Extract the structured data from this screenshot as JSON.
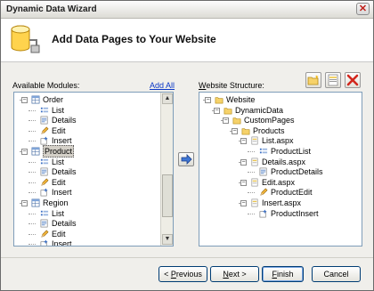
{
  "window": {
    "title": "Dynamic Data Wizard"
  },
  "header": {
    "title": "Add Data Pages to Your Website"
  },
  "modules": {
    "label": "Available Modules:",
    "add_all": "Add All",
    "items": [
      {
        "text": "Order",
        "icon": "table-icon",
        "indent": 0,
        "expander": "-"
      },
      {
        "text": "List",
        "icon": "list-icon",
        "indent": 1
      },
      {
        "text": "Details",
        "icon": "details-icon",
        "indent": 1
      },
      {
        "text": "Edit",
        "icon": "pencil-icon",
        "indent": 1
      },
      {
        "text": "Insert",
        "icon": "insert-icon",
        "indent": 1
      },
      {
        "text": "Product",
        "icon": "table-icon",
        "indent": 0,
        "expander": "-",
        "selected": true
      },
      {
        "text": "List",
        "icon": "list-icon",
        "indent": 1
      },
      {
        "text": "Details",
        "icon": "details-icon",
        "indent": 1
      },
      {
        "text": "Edit",
        "icon": "pencil-icon",
        "indent": 1
      },
      {
        "text": "Insert",
        "icon": "insert-icon",
        "indent": 1
      },
      {
        "text": "Region",
        "icon": "table-icon",
        "indent": 0,
        "expander": "-"
      },
      {
        "text": "List",
        "icon": "list-icon",
        "indent": 1
      },
      {
        "text": "Details",
        "icon": "details-icon",
        "indent": 1
      },
      {
        "text": "Edit",
        "icon": "pencil-icon",
        "indent": 1
      },
      {
        "text": "Insert",
        "icon": "insert-icon",
        "indent": 1
      }
    ]
  },
  "structure": {
    "label": "Website Structure:",
    "items": [
      {
        "text": "Website",
        "icon": "folder-icon",
        "indent": 0,
        "expander": "-"
      },
      {
        "text": "DynamicData",
        "icon": "folder-icon",
        "indent": 1,
        "expander": "-"
      },
      {
        "text": "CustomPages",
        "icon": "folder-icon",
        "indent": 2,
        "expander": "-"
      },
      {
        "text": "Products",
        "icon": "folder-icon",
        "indent": 3,
        "expander": "-"
      },
      {
        "text": "List.aspx",
        "icon": "page-icon",
        "indent": 4,
        "expander": "-"
      },
      {
        "text": "ProductList",
        "icon": "list-icon",
        "indent": 5
      },
      {
        "text": "Details.aspx",
        "icon": "page-icon",
        "indent": 4,
        "expander": "-"
      },
      {
        "text": "ProductDetails",
        "icon": "details-icon",
        "indent": 5
      },
      {
        "text": "Edit.aspx",
        "icon": "page-icon",
        "indent": 4,
        "expander": "-"
      },
      {
        "text": "ProductEdit",
        "icon": "pencil-icon",
        "indent": 5
      },
      {
        "text": "Insert.aspx",
        "icon": "page-icon",
        "indent": 4,
        "expander": "-"
      },
      {
        "text": "ProductInsert",
        "icon": "insert-icon",
        "indent": 5
      }
    ]
  },
  "toolbar": {
    "new_folder": "new-folder-icon",
    "new_page": "new-page-icon",
    "delete": "delete-icon"
  },
  "buttons": {
    "previous_pre": "< ",
    "previous_u": "P",
    "previous_post": "revious",
    "next_u": "N",
    "next_post": "ext >",
    "finish_u": "F",
    "finish_post": "inish",
    "cancel": "Cancel"
  },
  "colors": {
    "link": "#0b37c7",
    "selection": "#d4d0c8"
  }
}
